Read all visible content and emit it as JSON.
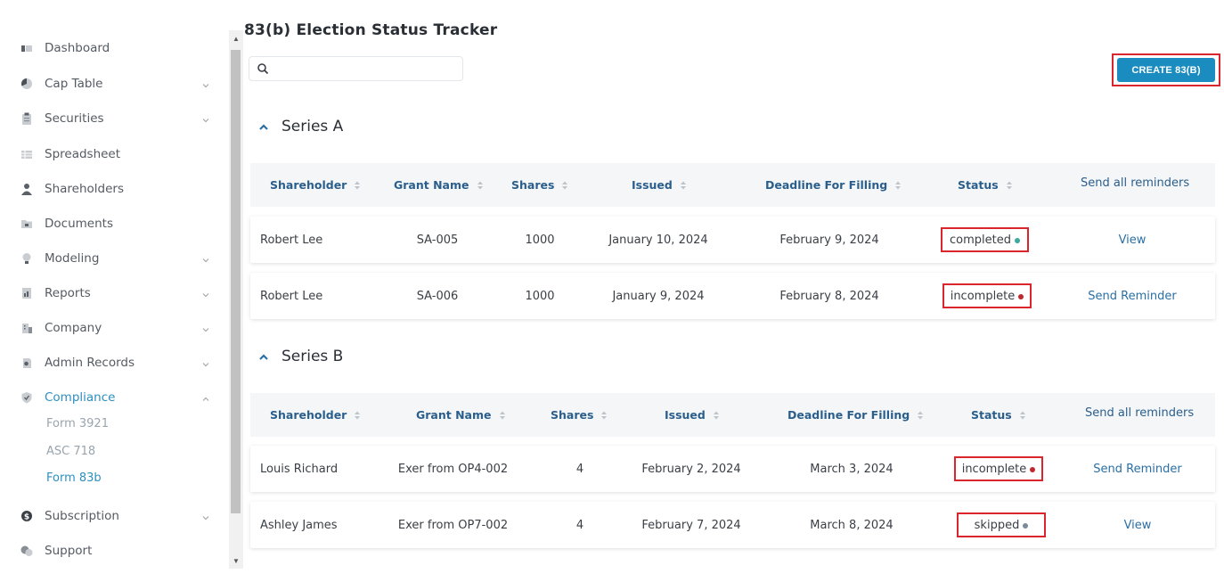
{
  "sidebar": {
    "items": [
      {
        "label": "Dashboard"
      },
      {
        "label": "Cap Table"
      },
      {
        "label": "Securities"
      },
      {
        "label": "Spreadsheet"
      },
      {
        "label": "Shareholders"
      },
      {
        "label": "Documents"
      },
      {
        "label": "Modeling"
      },
      {
        "label": "Reports"
      },
      {
        "label": "Company"
      },
      {
        "label": "Admin Records"
      },
      {
        "label": "Compliance"
      },
      {
        "label": "Subscription"
      },
      {
        "label": "Support"
      }
    ],
    "compliance_sub": [
      {
        "label": "Form 3921"
      },
      {
        "label": "ASC 718"
      },
      {
        "label": "Form 83b"
      }
    ]
  },
  "page": {
    "title": "83(b) Election Status Tracker",
    "search_placeholder": "",
    "create_button": "CREATE 83(B)"
  },
  "columns": {
    "shareholder": "Shareholder",
    "grant_name": "Grant Name",
    "shares": "Shares",
    "issued": "Issued",
    "deadline": "Deadline For Filling",
    "status": "Status",
    "send_all": "Send all reminders"
  },
  "colors": {
    "completed": "#3aa99f",
    "incomplete": "#c0282f",
    "skipped": "#7a8a9a",
    "accent": "#1a8cc0",
    "highlight": "#d8262c"
  },
  "sections": [
    {
      "name": "Series A",
      "rows": [
        {
          "shareholder": "Robert Lee",
          "grant": "SA-005",
          "shares": "1000",
          "issued": "January 10, 2024",
          "deadline": "February 9, 2024",
          "status": "completed",
          "action": "View"
        },
        {
          "shareholder": "Robert Lee",
          "grant": "SA-006",
          "shares": "1000",
          "issued": "January 9, 2024",
          "deadline": "February 8, 2024",
          "status": "incomplete",
          "action": "Send Reminder"
        }
      ]
    },
    {
      "name": "Series B",
      "rows": [
        {
          "shareholder": "Louis Richard",
          "grant": "Exer from OP4-002",
          "shares": "4",
          "issued": "February 2, 2024",
          "deadline": "March 3, 2024",
          "status": "incomplete",
          "action": "Send Reminder"
        },
        {
          "shareholder": "Ashley James",
          "grant": "Exer from OP7-002",
          "shares": "4",
          "issued": "February 7, 2024",
          "deadline": "March 8, 2024",
          "status": "skipped",
          "action": "View"
        }
      ]
    }
  ]
}
